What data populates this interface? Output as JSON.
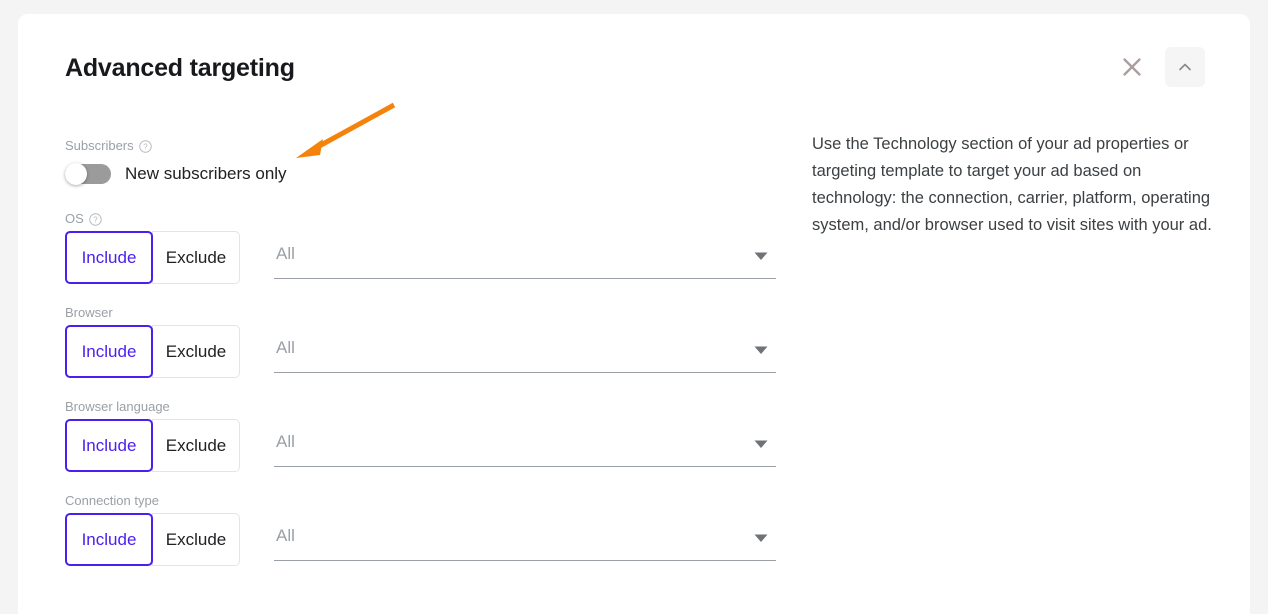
{
  "header": {
    "title": "Advanced targeting",
    "close_icon": "close-icon",
    "collapse_icon": "chevron-up-icon"
  },
  "help_panel": {
    "text": "Use the Technology section of your ad properties or targeting template to target your ad based on technology: the connection, carrier, platform, operating system, and/or browser used to visit sites with your ad."
  },
  "subscribers": {
    "label": "Subscribers",
    "help_icon": "help-circle-icon",
    "toggle_caption": "New subscribers only",
    "toggle_state": "off"
  },
  "fields": [
    {
      "label": "OS",
      "has_help": true,
      "help_icon": "help-circle-icon",
      "include_label": "Include",
      "exclude_label": "Exclude",
      "selected_mode": "Include",
      "select_value": "All",
      "dropdown_icon": "chevron-down-icon"
    },
    {
      "label": "Browser",
      "has_help": false,
      "include_label": "Include",
      "exclude_label": "Exclude",
      "selected_mode": "Include",
      "select_value": "All",
      "dropdown_icon": "chevron-down-icon"
    },
    {
      "label": "Browser language",
      "has_help": false,
      "include_label": "Include",
      "exclude_label": "Exclude",
      "selected_mode": "Include",
      "select_value": "All",
      "dropdown_icon": "chevron-down-icon"
    },
    {
      "label": "Connection type",
      "has_help": false,
      "include_label": "Include",
      "exclude_label": "Exclude",
      "selected_mode": "Include",
      "select_value": "All",
      "dropdown_icon": "chevron-down-icon"
    }
  ],
  "annotation": {
    "type": "arrow",
    "color": "#f5820b",
    "points_to": "new-subscribers-toggle"
  },
  "colors": {
    "accent": "#4b20ef",
    "page_background": "#f4f4f5",
    "card_background": "#ffffff",
    "label_gray": "#9aa0a6",
    "text_dark": "#202124",
    "toggle_track": "#9b9b9b",
    "annotation_orange": "#f5820b"
  }
}
